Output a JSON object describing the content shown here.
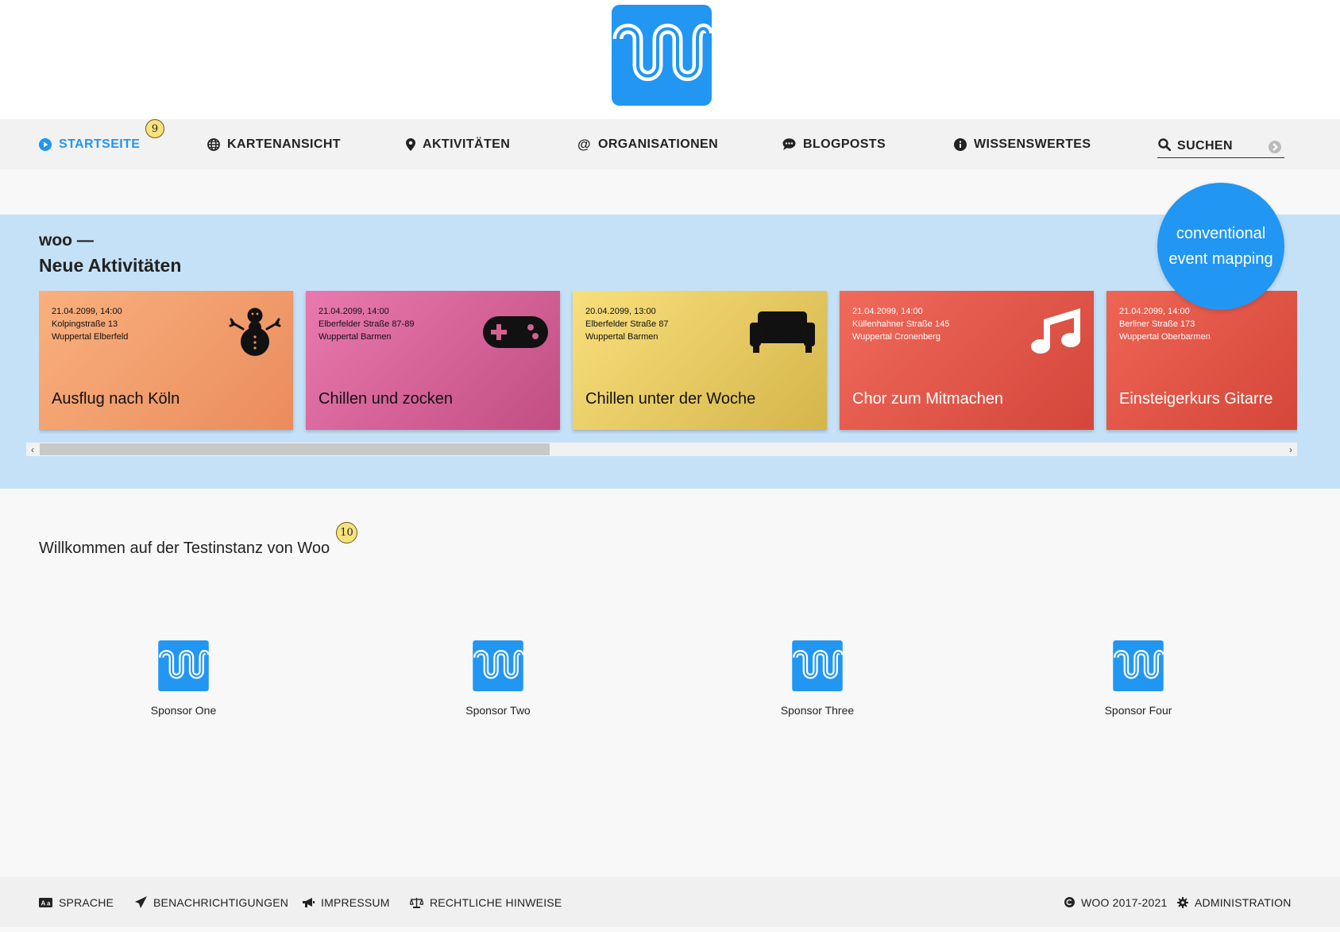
{
  "brand": {
    "logo_color": "#2196f3",
    "accent": "#2196f3"
  },
  "nav": {
    "items": [
      {
        "label": "STARTSEITE",
        "icon": "play-circle-icon",
        "active": true
      },
      {
        "label": "KARTENANSICHT",
        "icon": "globe-icon"
      },
      {
        "label": "AKTIVITÄTEN",
        "icon": "map-pin-icon"
      },
      {
        "label": "ORGANISATIONEN",
        "icon": "at-sign-icon"
      },
      {
        "label": "BLOGPOSTS",
        "icon": "speech-bubble-icon"
      },
      {
        "label": "WISSENSWERTES",
        "icon": "info-icon"
      }
    ],
    "search": {
      "placeholder": "SUCHEN",
      "icon": "search-icon",
      "submit_icon": "arrow-circle-right-icon"
    }
  },
  "hints": {
    "nav_hint": "9",
    "welcome_hint": "10"
  },
  "activities": {
    "label": "woo —",
    "title": "Neue Aktivitäten",
    "badge": {
      "line1": "conventional",
      "line2": "event mapping"
    },
    "cards": [
      {
        "date": "21.04.2099, 14:00",
        "street": "Kolpingstraße 13",
        "city": "Wuppertal Elberfeld",
        "title": "Ausflug nach Köln",
        "icon": "snowman-icon",
        "color_from": "#f9b07d",
        "color_to": "#ea8c5d",
        "text_color": "#111111"
      },
      {
        "date": "21.04.2099, 14:00",
        "street": "Elberfelder Straße 87-89",
        "city": "Wuppertal Barmen",
        "title": "Chillen und zocken",
        "icon": "gamepad-icon",
        "color_from": "#e979ae",
        "color_to": "#c24e82",
        "text_color": "#111111"
      },
      {
        "date": "20.04.2099, 13:00",
        "street": "Elberfelder Straße 87",
        "city": "Wuppertal Barmen",
        "title": "Chillen unter der Woche",
        "icon": "sofa-icon",
        "color_from": "#f9df7c",
        "color_to": "#d4b54a",
        "text_color": "#111111"
      },
      {
        "date": "21.04.2099, 14:00",
        "street": "Küllenhahner Straße 145",
        "city": "Wuppertal Cronenberg",
        "title": "Chor zum Mitmachen",
        "icon": "music-note-icon",
        "color_from": "#f06a5a",
        "color_to": "#d3463b",
        "text_color": "#ffffff"
      },
      {
        "date": "21.04.2099, 14:00",
        "street": "Berliner Straße 173",
        "city": "Wuppertal Oberbarmen",
        "title": "Einsteigerkurs Gitarre",
        "icon": "guitar-icon",
        "color_from": "#ee6555",
        "color_to": "#cf4034",
        "text_color": "#ffffff"
      }
    ]
  },
  "carousel": {
    "scroll_left": "‹",
    "scroll_right": "›",
    "scroll_progress": 0.41
  },
  "welcome": {
    "text": "Willkommen auf der Testinstanz von Woo"
  },
  "sponsors": [
    {
      "name": "Sponsor One"
    },
    {
      "name": "Sponsor Two"
    },
    {
      "name": "Sponsor Three"
    },
    {
      "name": "Sponsor Four"
    }
  ],
  "footer": {
    "left": [
      {
        "label": "SPRACHE",
        "icon": "language-icon"
      },
      {
        "label": "BENACHRICHTIGUNGEN",
        "icon": "paper-plane-icon"
      },
      {
        "label": "IMPRESSUM",
        "icon": "megaphone-icon"
      },
      {
        "label": "RECHTLICHE HINWEISE",
        "icon": "scale-icon"
      }
    ],
    "right": [
      {
        "label": "WOO 2017-2021",
        "icon": "copyright-icon"
      },
      {
        "label": "ADMINISTRATION",
        "icon": "gear-icon"
      }
    ]
  }
}
